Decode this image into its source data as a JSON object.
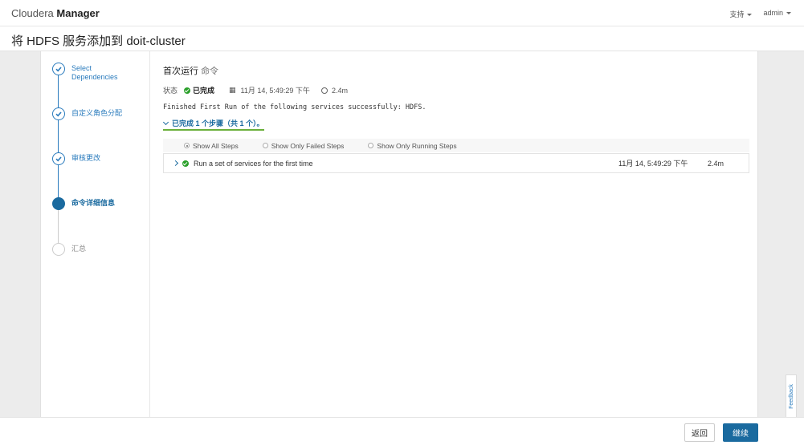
{
  "topbar": {
    "brand_light": "Cloudera",
    "brand_bold": "Manager",
    "support": "支持",
    "user": "admin"
  },
  "page": {
    "title": "将 HDFS 服务添加到 doit-cluster"
  },
  "wizard_steps": [
    {
      "line1": "Select",
      "line2": "Dependencies",
      "state": "done"
    },
    {
      "line1": "自定义角色分配",
      "line2": "",
      "state": "done"
    },
    {
      "line1": "审核更改",
      "line2": "",
      "state": "done"
    },
    {
      "line1": "命令详细信息",
      "line2": "",
      "state": "active"
    },
    {
      "line1": "汇总",
      "line2": "",
      "state": "todo"
    }
  ],
  "command": {
    "title": "首次运行",
    "title_suffix": "命令",
    "status_label": "状态",
    "status_value": "已完成",
    "start_time": "11月 14, 5:49:29 下午",
    "duration": "2.4m",
    "message": "Finished First Run of the following services successfully: HDFS.",
    "completed_steps": "已完成 1 个步骤（共 1 个）。"
  },
  "filters": {
    "all": "Show All Steps",
    "failed": "Show Only Failed Steps",
    "running": "Show Only Running Steps"
  },
  "step_rows": [
    {
      "name": "Run a set of services for the first time",
      "time": "11月 14, 5:49:29 下午",
      "duration": "2.4m"
    }
  ],
  "footer": {
    "back": "返回",
    "next": "继续"
  },
  "feedback": "Feedback",
  "colors": {
    "accent": "#1a6a9f",
    "success": "#2aa02a",
    "underline": "#6aaf3a"
  }
}
